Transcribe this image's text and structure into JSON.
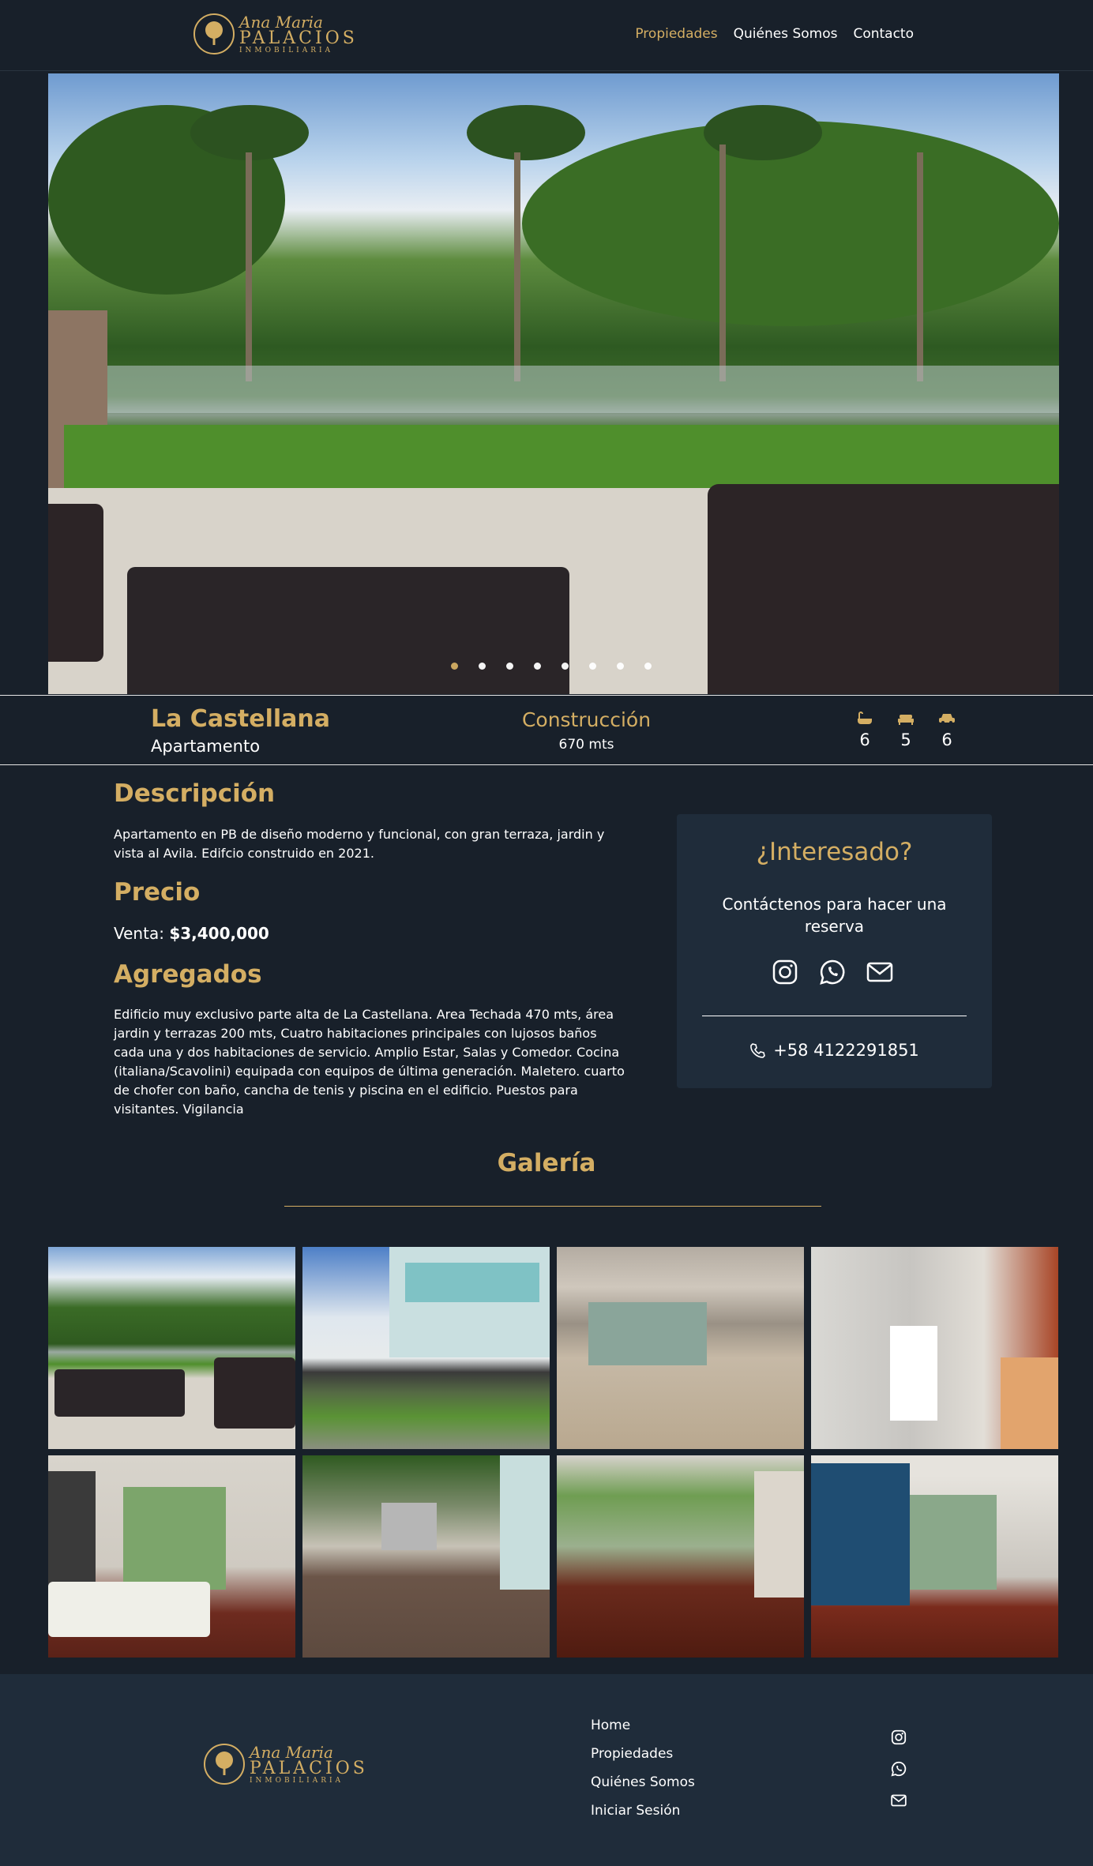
{
  "brand": {
    "script": "Ana Maria",
    "name": "PALACIOS",
    "tagline": "INMOBILIARIA"
  },
  "nav": {
    "items": [
      "Propiedades",
      "Quiénes Somos",
      "Contacto"
    ],
    "active": "Propiedades"
  },
  "hero": {
    "slide_count": 8,
    "active_slide": 1
  },
  "property": {
    "title": "La Castellana",
    "type": "Apartamento",
    "status": "Construcción",
    "area": "670 mts",
    "baths": "6",
    "beds": "5",
    "parking": "6"
  },
  "description": {
    "heading": "Descripción",
    "text": "Apartamento en PB de diseño moderno y funcional, con gran terraza, jardin y vista al Avila. Edifcio construido en 2021."
  },
  "price": {
    "heading": "Precio",
    "label": "Venta:",
    "value": "$3,400,000"
  },
  "extras": {
    "heading": "Agregados",
    "text": "Edificio muy exclusivo parte alta de La Castellana. Area Techada 470 mts, área jardin y terrazas 200 mts, Cuatro habitaciones principales con lujosos baños cada una y dos habitaciones de servicio. Amplio Estar, Salas y Comedor. Cocina (italiana/Scavolini) equipada con equipos de última generación. Maletero. cuarto de chofer con baño, cancha de tenis y piscina en el edificio. Puestos para visitantes. Vigilancia"
  },
  "contact_card": {
    "title": "¿Interesado?",
    "subtitle": "Contáctenos para hacer una reserva",
    "icons": [
      "instagram-icon",
      "whatsapp-icon",
      "mail-icon"
    ],
    "phone": "+58 4122291851"
  },
  "gallery": {
    "title": "Galería",
    "photos": [
      "terrace-garden",
      "building-exterior",
      "living-room",
      "kitchen",
      "bedroom",
      "bbq-terrace",
      "room-windows",
      "blue-wall-room"
    ]
  },
  "footer": {
    "links": [
      "Home",
      "Propiedades",
      "Quiénes Somos",
      "Iniciar Sesión"
    ],
    "icons": [
      "instagram-icon",
      "whatsapp-icon",
      "mail-icon"
    ]
  },
  "colors": {
    "accent": "#d4ae63",
    "background": "#18202a",
    "card": "#1f2c3a"
  }
}
